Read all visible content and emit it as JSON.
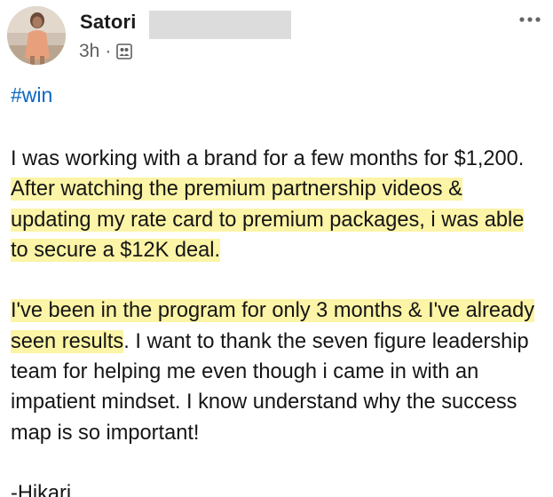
{
  "post": {
    "author": {
      "name": "Satori",
      "time": "3h",
      "separator": "·",
      "audience_icon": "people-icon",
      "avatar_icon": "profile-photo"
    },
    "more_icon": "ellipsis-icon",
    "hashtag": "#win",
    "paragraphs": [
      {
        "segments": [
          {
            "text": "I was working with a brand for a few months for $1,200. ",
            "highlight": false
          },
          {
            "text": "After watching the premium partnership videos & updating my rate card to premium packages, i was able to secure a $12K deal.",
            "highlight": true
          }
        ]
      },
      {
        "segments": [
          {
            "text": "I've been in the program for only 3 months & I've already seen results",
            "highlight": true
          },
          {
            "text": ". I want to thank the seven figure leadership team for helping me even though i came in with an impatient mindset. I know understand why the success map is so important!",
            "highlight": false
          }
        ]
      },
      {
        "segments": [
          {
            "text": "-Hikari",
            "highlight": false
          }
        ]
      }
    ],
    "colors": {
      "highlight": "#fcf4a6",
      "hashtag": "#0b66c2",
      "meta": "#5f5f5f"
    }
  }
}
